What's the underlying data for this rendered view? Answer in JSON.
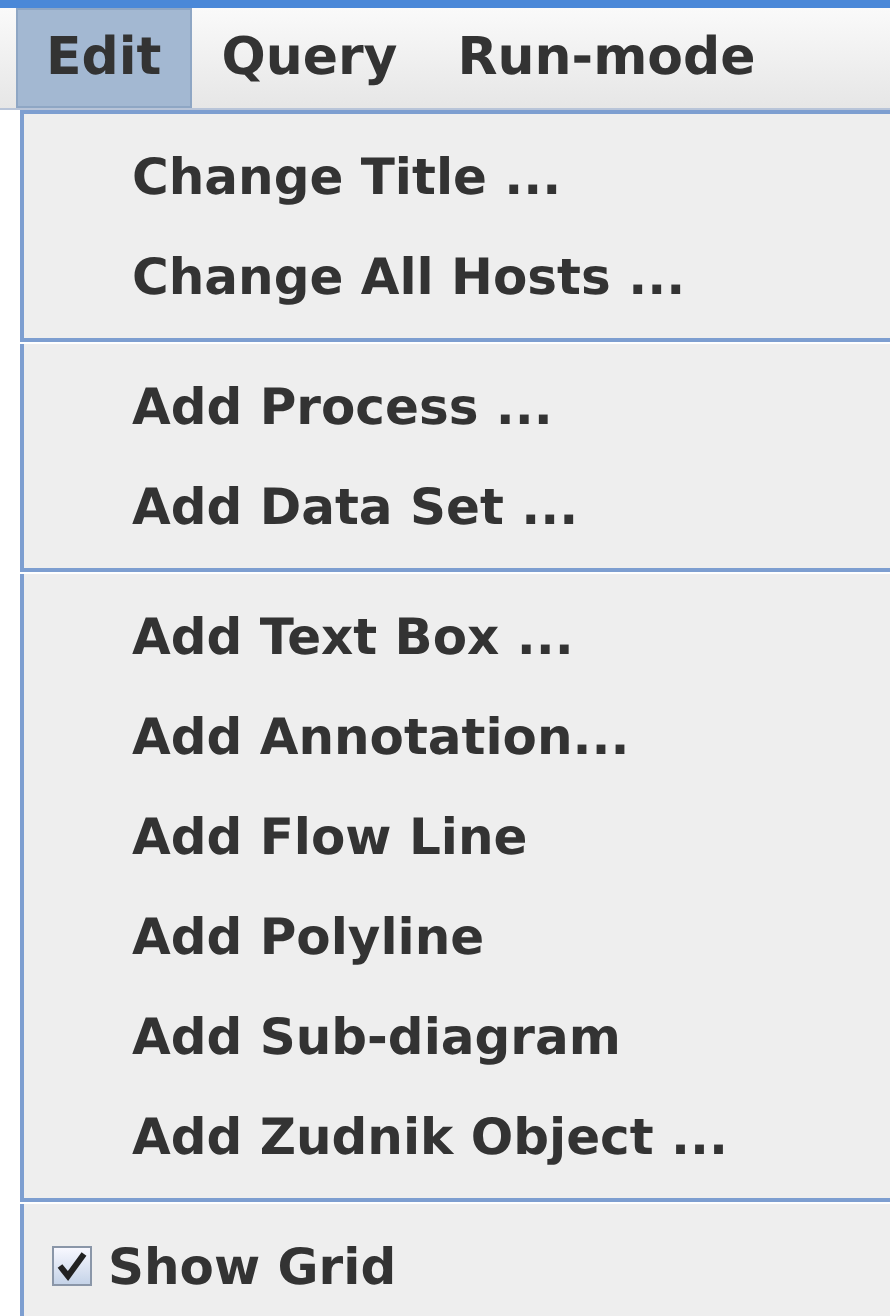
{
  "menubar": [
    {
      "label": "Edit",
      "selected": true
    },
    {
      "label": "Query",
      "selected": false
    },
    {
      "label": "Run-mode",
      "selected": false
    }
  ],
  "menu": {
    "items": [
      {
        "kind": "item",
        "label": "Change Title ..."
      },
      {
        "kind": "item",
        "label": "Change All Hosts ..."
      },
      {
        "kind": "separator"
      },
      {
        "kind": "item",
        "label": "Add Process ..."
      },
      {
        "kind": "item",
        "label": "Add Data Set ..."
      },
      {
        "kind": "separator"
      },
      {
        "kind": "item",
        "label": "Add Text Box ..."
      },
      {
        "kind": "item",
        "label": "Add Annotation..."
      },
      {
        "kind": "item",
        "label": "Add Flow Line"
      },
      {
        "kind": "item",
        "label": "Add Polyline"
      },
      {
        "kind": "item",
        "label": "Add Sub-diagram"
      },
      {
        "kind": "item",
        "label": "Add Zudnik Object ..."
      },
      {
        "kind": "separator"
      },
      {
        "kind": "checkbox",
        "label": "Show Grid",
        "checked": true
      }
    ]
  }
}
